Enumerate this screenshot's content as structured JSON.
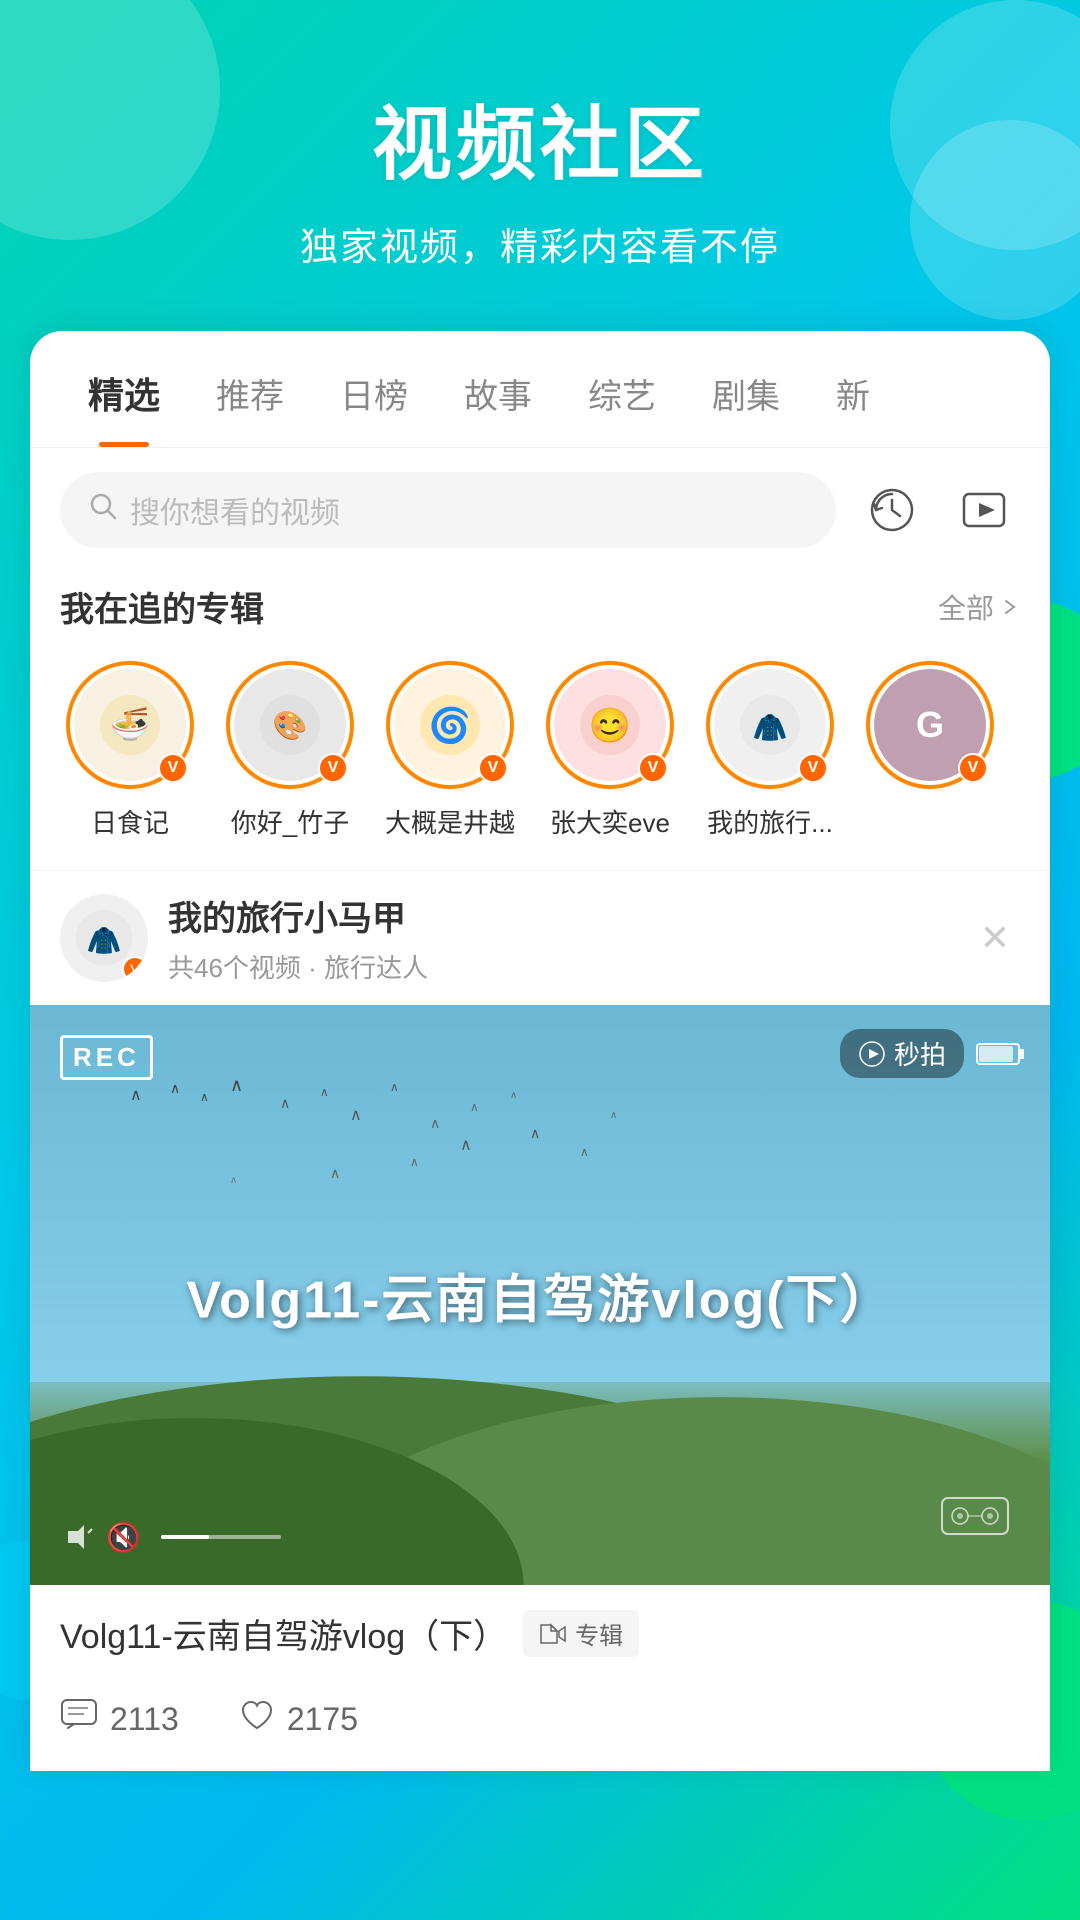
{
  "header": {
    "title": "视频社区",
    "subtitle": "独家视频，精彩内容看不停"
  },
  "tabs": [
    {
      "label": "精选",
      "active": true
    },
    {
      "label": "推荐",
      "active": false
    },
    {
      "label": "日榜",
      "active": false
    },
    {
      "label": "故事",
      "active": false
    },
    {
      "label": "综艺",
      "active": false
    },
    {
      "label": "剧集",
      "active": false
    },
    {
      "label": "新",
      "active": false
    }
  ],
  "search": {
    "placeholder": "搜你想看的视频"
  },
  "section_following": {
    "title": "我在追的专辑",
    "more": "全部"
  },
  "avatars": [
    {
      "name": "日食记",
      "emoji": "🍜",
      "bg": "#f8f0e0"
    },
    {
      "name": "你好_竹子",
      "emoji": "🎨",
      "bg": "#e8e8e8"
    },
    {
      "name": "大概是井越",
      "emoji": "🌀",
      "bg": "#fff3e0"
    },
    {
      "name": "张大奕eve",
      "emoji": "😊",
      "bg": "#ffe0e0"
    },
    {
      "name": "我的旅行...",
      "emoji": "🧥",
      "bg": "#f0f0f0"
    },
    {
      "name": "G",
      "emoji": "G",
      "bg": "#e0a0a0"
    }
  ],
  "channel": {
    "name": "我的旅行小马甲",
    "meta": "共46个视频 · 旅行达人",
    "emoji": "🧥"
  },
  "video": {
    "rec_text": "REC",
    "title_overlay": "Volg11-云南自驾游vlog(下）",
    "title": "Volg11-云南自驾游vlog（下）",
    "album_label": "专辑",
    "comments": "2113",
    "likes": "2175",
    "miao_label": "秒拍",
    "volume_icon": "🔇",
    "battery_text": ""
  }
}
